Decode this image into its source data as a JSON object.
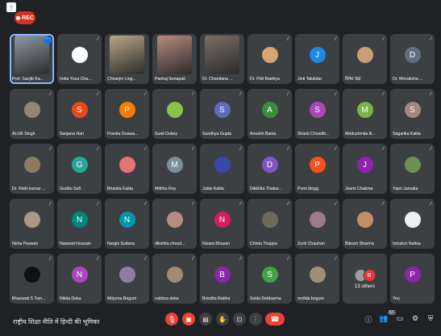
{
  "rec_label": "REC",
  "participants": [
    {
      "name": "Prof. Sanjib Ka...",
      "avatar": "photo",
      "color": "#8d99a6",
      "video": true,
      "active": true,
      "mic": false,
      "more": true
    },
    {
      "name": "India Yuva Cha...",
      "avatar": "photo",
      "color": "#ffffff",
      "video": false,
      "mic": true
    },
    {
      "name": "Chiranjiv Ling...",
      "avatar": "photo",
      "color": "#b9a888",
      "video": true,
      "mic": false
    },
    {
      "name": "Pankaj Senapati",
      "avatar": "photo",
      "color": "#b98b7e",
      "video": true,
      "mic": false
    },
    {
      "name": "Dr. Chandana ...",
      "avatar": "photo",
      "color": "#7a6f65",
      "video": true,
      "mic": false
    },
    {
      "name": "Dr. Priti Baishya",
      "avatar": "photo",
      "color": "#d7a56f",
      "video": false,
      "mic": true
    },
    {
      "name": "Jinti Talukdar",
      "avatar": "J",
      "color": "#1e88e5",
      "video": false,
      "mic": true
    },
    {
      "name": "दिनेश चंद्रा",
      "avatar": "photo",
      "color": "#c89f74",
      "video": false,
      "mic": true
    },
    {
      "name": "Dr. Monalisha ...",
      "avatar": "D",
      "color": "#5f6f7f",
      "video": false,
      "mic": true
    },
    {
      "name": "ALOK Singh",
      "avatar": "photo",
      "color": "#8f8775",
      "video": false,
      "mic": true
    },
    {
      "name": "Sanjana Hari",
      "avatar": "S",
      "color": "#e64a19",
      "video": false,
      "mic": true
    },
    {
      "name": "Pranita Goswa...",
      "avatar": "P",
      "color": "#f57c00",
      "video": false,
      "mic": true
    },
    {
      "name": "Sunil Dubey",
      "avatar": "photo",
      "color": "#8bc34a",
      "video": false,
      "mic": true
    },
    {
      "name": "Sandhya Gupta",
      "avatar": "S",
      "color": "#5c6bc0",
      "video": false,
      "mic": true
    },
    {
      "name": "Anushri Bania",
      "avatar": "A",
      "color": "#388e3c",
      "video": false,
      "mic": true
    },
    {
      "name": "Shanti Chowdh...",
      "avatar": "S",
      "color": "#ab47bc",
      "video": false,
      "mic": true
    },
    {
      "name": "Mridushmita B...",
      "avatar": "M",
      "color": "#7cb342",
      "video": false,
      "mic": true
    },
    {
      "name": "Sagarika Kalita",
      "avatar": "S",
      "color": "#a1887f",
      "video": false,
      "mic": true
    },
    {
      "name": "Dr. Rishi kumar ...",
      "avatar": "photo",
      "color": "#8a7b5e",
      "video": false,
      "mic": true
    },
    {
      "name": "Guddu Safi",
      "avatar": "G",
      "color": "#26a69a",
      "video": false,
      "mic": true
    },
    {
      "name": "Bhanita Kalita",
      "avatar": "photo",
      "color": "#e57373",
      "video": false,
      "mic": true
    },
    {
      "name": "Mithhu Roy",
      "avatar": "M",
      "color": "#78909c",
      "video": false,
      "mic": true
    },
    {
      "name": "Juble Kalita",
      "avatar": "photo",
      "color": "#3949ab",
      "video": false,
      "mic": true
    },
    {
      "name": "Dikkhita Thakur...",
      "avatar": "D",
      "color": "#7e57c2",
      "video": false,
      "mic": true
    },
    {
      "name": "Pomi blogg",
      "avatar": "P",
      "color": "#f4511e",
      "video": false,
      "mic": true
    },
    {
      "name": "Jesmi Chakma",
      "avatar": "J",
      "color": "#8e24aa",
      "video": false,
      "mic": true
    },
    {
      "name": "Yapri Jamatia",
      "avatar": "photo",
      "color": "#6d8f52",
      "video": false,
      "mic": true
    },
    {
      "name": "Neha Paswan",
      "avatar": "photo",
      "color": "#a89a86",
      "video": false,
      "mic": true
    },
    {
      "name": "Nawsad Hussain",
      "avatar": "N",
      "color": "#00897b",
      "video": false,
      "mic": true
    },
    {
      "name": "Nargis Sultana",
      "avatar": "N",
      "color": "#0097a7",
      "video": false,
      "mic": true
    },
    {
      "name": "dikshita choud...",
      "avatar": "photo",
      "color": "#b58c82",
      "video": false,
      "mic": true
    },
    {
      "name": "Nizara Bhuyan",
      "avatar": "N",
      "color": "#d81b60",
      "video": false,
      "mic": true
    },
    {
      "name": "Chintu Thappa",
      "avatar": "photo",
      "color": "#6e6a5c",
      "video": false,
      "mic": true
    },
    {
      "name": "Zyoti Chauhan",
      "avatar": "photo",
      "color": "#9b7b8a",
      "video": false,
      "mic": true
    },
    {
      "name": "Bikram Sharma",
      "avatar": "photo",
      "color": "#c28f6b",
      "video": false,
      "mic": true
    },
    {
      "name": "Ismatun Nafisa",
      "avatar": "photo",
      "color": "#efefef",
      "video": false,
      "mic": true
    },
    {
      "name": "Bhaswati S Tam...",
      "avatar": "photo",
      "color": "#111111",
      "video": false,
      "mic": true
    },
    {
      "name": "Nikita Deka",
      "avatar": "N",
      "color": "#ab47bc",
      "video": false,
      "mic": true
    },
    {
      "name": "Mirjuma Begum",
      "avatar": "photo",
      "color": "#8f7e9e",
      "video": false,
      "mic": true
    },
    {
      "name": "raktima deka",
      "avatar": "photo",
      "color": "#a08a78",
      "video": false,
      "mic": true
    },
    {
      "name": "Bondita Rabha",
      "avatar": "B",
      "color": "#8e24aa",
      "video": false,
      "mic": true
    },
    {
      "name": "Sukla Debbarma",
      "avatar": "S",
      "color": "#43a047",
      "video": false,
      "mic": true
    },
    {
      "name": "mofida begum",
      "avatar": "photo",
      "color": "#9e8f78",
      "video": false,
      "mic": true
    },
    {
      "name": "13 others",
      "others": true,
      "mic": false
    },
    {
      "name": "You",
      "avatar": "P",
      "color": "#8e24aa",
      "video": false,
      "mic": false
    }
  ],
  "others_avatars": [
    {
      "letter": "",
      "color": "#9e9e9e"
    },
    {
      "letter": "R",
      "color": "#e53935"
    }
  ],
  "meeting_title": "राष्ट्रीय शिक्षा नीति में हिन्दी की भूमिका",
  "participant_badge": "57"
}
